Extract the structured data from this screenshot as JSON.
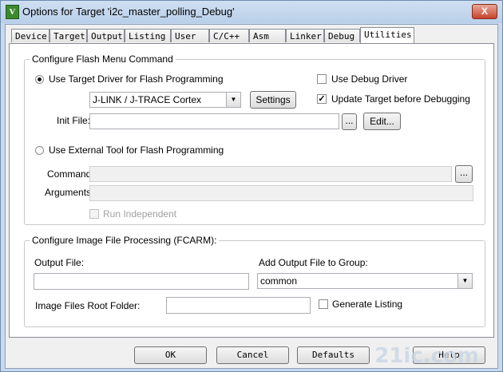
{
  "window": {
    "title": "Options for Target 'i2c_master_polling_Debug'",
    "close_glyph": "X",
    "app_icon_glyph": "V"
  },
  "tabs": [
    {
      "label": "Device"
    },
    {
      "label": "Target"
    },
    {
      "label": "Output"
    },
    {
      "label": "Listing"
    },
    {
      "label": "User"
    },
    {
      "label": "C/C++"
    },
    {
      "label": "Asm"
    },
    {
      "label": "Linker"
    },
    {
      "label": "Debug"
    },
    {
      "label": "Utilities"
    }
  ],
  "flash": {
    "group_title": "Configure Flash Menu Command",
    "use_target_driver": "Use Target Driver for Flash Programming",
    "driver_value": "J-LINK / J-TRACE Cortex",
    "settings_button": "Settings",
    "use_debug_driver": "Use Debug Driver",
    "update_target": "Update Target before Debugging",
    "init_file_label": "Init File:",
    "init_file_value": "",
    "browse_button": "...",
    "edit_button": "Edit...",
    "use_external_tool": "Use External Tool for Flash Programming",
    "command_label": "Command:",
    "arguments_label": "Arguments:",
    "run_independent": "Run Independent",
    "use_target_driver_checked": true,
    "use_debug_driver_checked": false,
    "update_target_checked": true,
    "checkmark_glyph": "✓"
  },
  "image": {
    "group_title": "Configure Image File Processing (FCARM):",
    "output_file_label": "Output File:",
    "output_file_value": "",
    "add_group_label": "Add Output File  to Group:",
    "group_value": "common",
    "root_folder_label": "Image Files Root Folder:",
    "root_folder_value": "",
    "generate_listing": "Generate Listing",
    "generate_listing_checked": false
  },
  "buttons": {
    "ok": "OK",
    "cancel": "Cancel",
    "defaults": "Defaults",
    "help": "Help"
  },
  "watermark": "21ic.com"
}
